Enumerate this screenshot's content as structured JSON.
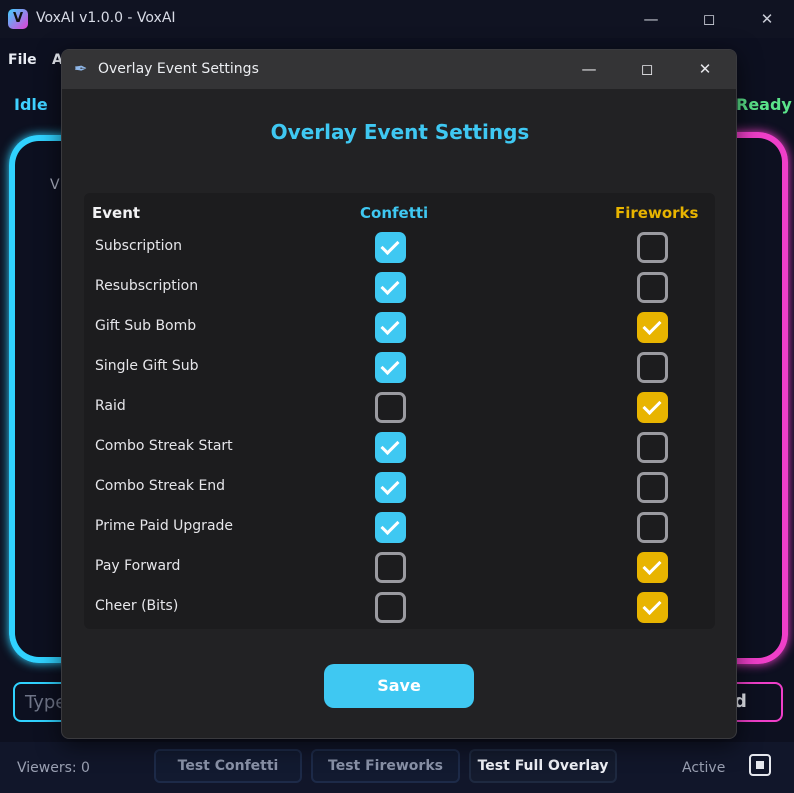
{
  "colors": {
    "confetti": "#3fc8f2",
    "fireworks": "#e8b400",
    "save_button": "#3fc8f2",
    "cyan_accent": "#30d2ff",
    "magenta_accent": "#ef3fc9",
    "ready_green": "#5be38a"
  },
  "main_window": {
    "title": "VoxAI v1.0.0 - VoxAI",
    "app_icon": "V",
    "menu": [
      "File",
      "A"
    ],
    "status_left": "Idle",
    "status_right": "Ready",
    "panel_text": "V",
    "input_placeholder": "Type",
    "send_label": "d",
    "viewers": "Viewers: 0",
    "test_confetti": "Test Confetti",
    "test_fireworks": "Test Fireworks",
    "test_full_overlay": "Test Full Overlay",
    "active_label": "Active"
  },
  "dialog": {
    "title": "Overlay Event Settings",
    "heading": "Overlay Event Settings",
    "columns": {
      "event": "Event",
      "confetti": "Confetti",
      "fireworks": "Fireworks"
    },
    "rows": [
      {
        "label": "Subscription",
        "confetti": true,
        "fireworks": false
      },
      {
        "label": "Resubscription",
        "confetti": true,
        "fireworks": false
      },
      {
        "label": "Gift Sub Bomb",
        "confetti": true,
        "fireworks": true
      },
      {
        "label": "Single Gift Sub",
        "confetti": true,
        "fireworks": false
      },
      {
        "label": "Raid",
        "confetti": false,
        "fireworks": true
      },
      {
        "label": "Combo Streak Start",
        "confetti": true,
        "fireworks": false
      },
      {
        "label": "Combo Streak End",
        "confetti": true,
        "fireworks": false
      },
      {
        "label": "Prime Paid Upgrade",
        "confetti": true,
        "fireworks": false
      },
      {
        "label": "Pay Forward",
        "confetti": false,
        "fireworks": true
      },
      {
        "label": "Cheer (Bits)",
        "confetti": false,
        "fireworks": true
      }
    ],
    "save_label": "Save"
  }
}
